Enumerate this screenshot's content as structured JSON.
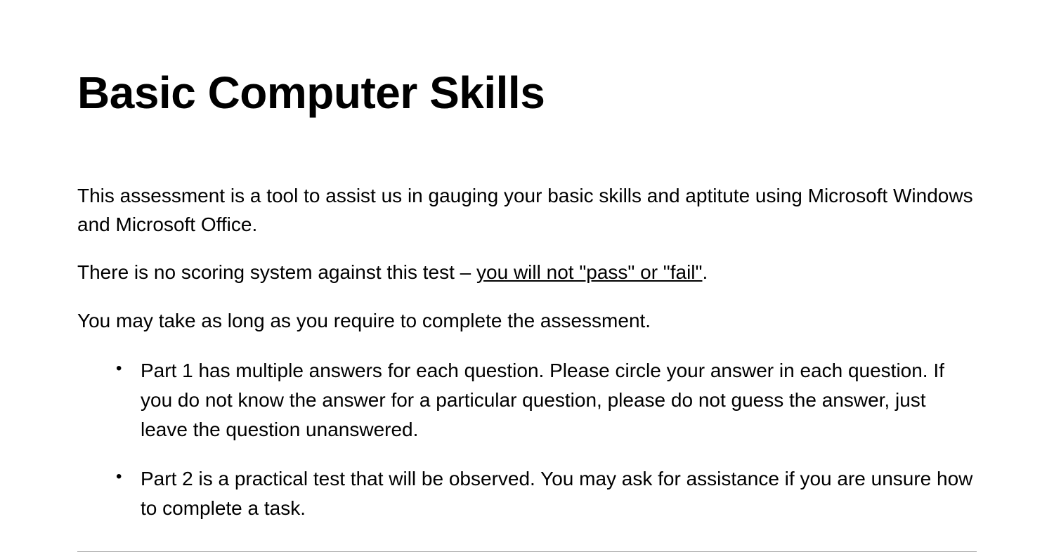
{
  "title": "Basic Computer Skills",
  "paragraphs": {
    "intro": "This assessment is a tool to assist us in gauging your basic skills and aptitute using Microsoft Windows and Microsoft Office.",
    "scoring_prefix": "There is no scoring system against this test – ",
    "scoring_underlined": "you will not \"pass\" or \"fail\"",
    "scoring_suffix": ".",
    "timing": "You may take as long as you require to complete the assessment."
  },
  "bullets": [
    "Part 1 has multiple answers for each question. Please circle your answer in each question. If you do not know the answer for a particular question, please do not guess the answer, just leave the question unanswered.",
    "Part 2 is a practical test that will be observed. You may ask for assistance if you are unsure how to complete a task."
  ]
}
